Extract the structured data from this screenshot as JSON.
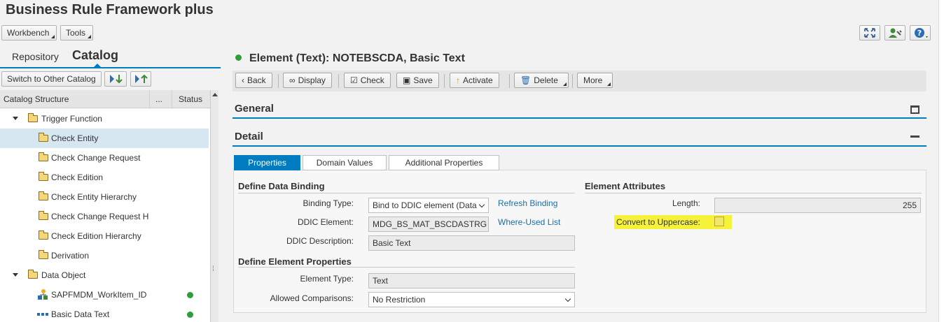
{
  "app": {
    "title": "Business Rule Framework plus"
  },
  "top_menu": {
    "workbench": "Workbench",
    "tools": "Tools"
  },
  "top_icons": [
    "fullscreen-icon",
    "user-settings-icon",
    "help-icon"
  ],
  "left": {
    "tabs": {
      "repository": "Repository",
      "catalog": "Catalog"
    },
    "switch_catalog": "Switch to Other Catalog",
    "header": {
      "structure": "Catalog Structure",
      "more": "...",
      "status": "Status"
    },
    "tree": [
      {
        "label": "Trigger Function",
        "level": 0,
        "expanded": true,
        "icon": "folder-icon"
      },
      {
        "label": "Check Entity",
        "level": 1,
        "selected": true,
        "icon": "folder-icon"
      },
      {
        "label": "Check Change Request",
        "level": 1,
        "icon": "folder-icon"
      },
      {
        "label": "Check Edition",
        "level": 1,
        "icon": "folder-icon"
      },
      {
        "label": "Check Entity Hierarchy",
        "level": 1,
        "icon": "folder-icon"
      },
      {
        "label": "Check Change Request Hi",
        "level": 1,
        "icon": "folder-icon"
      },
      {
        "label": "Check Edition Hierarchy",
        "level": 1,
        "icon": "folder-icon"
      },
      {
        "label": "Derivation",
        "level": 1,
        "icon": "folder-icon"
      },
      {
        "label": "Data Object",
        "level": 0,
        "expanded": true,
        "icon": "folder-icon"
      },
      {
        "label": "SAPFMDM_WorkItem_ID",
        "level": 1,
        "icon": "structure-icon",
        "status": "active"
      },
      {
        "label": "Basic Data Text",
        "level": 1,
        "icon": "element-icon",
        "status": "active"
      }
    ]
  },
  "element": {
    "title": "Element (Text): NOTEBSCDA, Basic Text"
  },
  "toolbar": {
    "back": "Back",
    "display": "Display",
    "check": "Check",
    "save": "Save",
    "activate": "Activate",
    "delete": "Delete",
    "more": "More"
  },
  "sections": {
    "general": "General",
    "detail": "Detail"
  },
  "detail_tabs": {
    "properties": "Properties",
    "domain_values": "Domain Values",
    "additional_properties": "Additional Properties"
  },
  "binding": {
    "title": "Define Data Binding",
    "binding_type_label": "Binding Type:",
    "binding_type_value": "Bind to DDIC element (Data",
    "refresh_link": "Refresh Binding",
    "ddic_element_label": "DDIC Element:",
    "ddic_element_value": "MDG_BS_MAT_BSCDASTRG",
    "where_used_link": "Where-Used List",
    "ddic_description_label": "DDIC Description:",
    "ddic_description_value": "Basic Text"
  },
  "element_props": {
    "title": "Define Element Properties",
    "element_type_label": "Element Type:",
    "element_type_value": "Text",
    "allowed_comparisons_label": "Allowed Comparisons:",
    "allowed_comparisons_value": "No Restriction"
  },
  "attributes": {
    "title": "Element Attributes",
    "length_label": "Length:",
    "length_value": "255",
    "uppercase_label": "Convert to Uppercase:",
    "highlight_color": "#f6f23a"
  },
  "colors": {
    "accent": "#007cc0",
    "status_green": "#2e9e3a"
  }
}
